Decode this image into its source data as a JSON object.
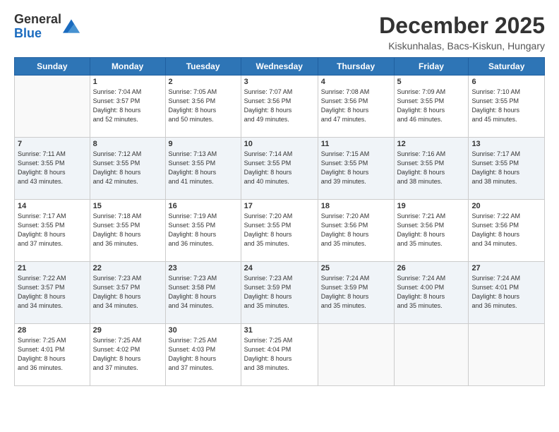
{
  "logo": {
    "line1": "General",
    "line2": "Blue"
  },
  "header": {
    "month": "December 2025",
    "location": "Kiskunhalas, Bacs-Kiskun, Hungary"
  },
  "weekdays": [
    "Sunday",
    "Monday",
    "Tuesday",
    "Wednesday",
    "Thursday",
    "Friday",
    "Saturday"
  ],
  "weeks": [
    [
      {
        "day": "",
        "info": ""
      },
      {
        "day": "1",
        "info": "Sunrise: 7:04 AM\nSunset: 3:57 PM\nDaylight: 8 hours\nand 52 minutes."
      },
      {
        "day": "2",
        "info": "Sunrise: 7:05 AM\nSunset: 3:56 PM\nDaylight: 8 hours\nand 50 minutes."
      },
      {
        "day": "3",
        "info": "Sunrise: 7:07 AM\nSunset: 3:56 PM\nDaylight: 8 hours\nand 49 minutes."
      },
      {
        "day": "4",
        "info": "Sunrise: 7:08 AM\nSunset: 3:56 PM\nDaylight: 8 hours\nand 47 minutes."
      },
      {
        "day": "5",
        "info": "Sunrise: 7:09 AM\nSunset: 3:55 PM\nDaylight: 8 hours\nand 46 minutes."
      },
      {
        "day": "6",
        "info": "Sunrise: 7:10 AM\nSunset: 3:55 PM\nDaylight: 8 hours\nand 45 minutes."
      }
    ],
    [
      {
        "day": "7",
        "info": "Sunrise: 7:11 AM\nSunset: 3:55 PM\nDaylight: 8 hours\nand 43 minutes."
      },
      {
        "day": "8",
        "info": "Sunrise: 7:12 AM\nSunset: 3:55 PM\nDaylight: 8 hours\nand 42 minutes."
      },
      {
        "day": "9",
        "info": "Sunrise: 7:13 AM\nSunset: 3:55 PM\nDaylight: 8 hours\nand 41 minutes."
      },
      {
        "day": "10",
        "info": "Sunrise: 7:14 AM\nSunset: 3:55 PM\nDaylight: 8 hours\nand 40 minutes."
      },
      {
        "day": "11",
        "info": "Sunrise: 7:15 AM\nSunset: 3:55 PM\nDaylight: 8 hours\nand 39 minutes."
      },
      {
        "day": "12",
        "info": "Sunrise: 7:16 AM\nSunset: 3:55 PM\nDaylight: 8 hours\nand 38 minutes."
      },
      {
        "day": "13",
        "info": "Sunrise: 7:17 AM\nSunset: 3:55 PM\nDaylight: 8 hours\nand 38 minutes."
      }
    ],
    [
      {
        "day": "14",
        "info": "Sunrise: 7:17 AM\nSunset: 3:55 PM\nDaylight: 8 hours\nand 37 minutes."
      },
      {
        "day": "15",
        "info": "Sunrise: 7:18 AM\nSunset: 3:55 PM\nDaylight: 8 hours\nand 36 minutes."
      },
      {
        "day": "16",
        "info": "Sunrise: 7:19 AM\nSunset: 3:55 PM\nDaylight: 8 hours\nand 36 minutes."
      },
      {
        "day": "17",
        "info": "Sunrise: 7:20 AM\nSunset: 3:55 PM\nDaylight: 8 hours\nand 35 minutes."
      },
      {
        "day": "18",
        "info": "Sunrise: 7:20 AM\nSunset: 3:56 PM\nDaylight: 8 hours\nand 35 minutes."
      },
      {
        "day": "19",
        "info": "Sunrise: 7:21 AM\nSunset: 3:56 PM\nDaylight: 8 hours\nand 35 minutes."
      },
      {
        "day": "20",
        "info": "Sunrise: 7:22 AM\nSunset: 3:56 PM\nDaylight: 8 hours\nand 34 minutes."
      }
    ],
    [
      {
        "day": "21",
        "info": "Sunrise: 7:22 AM\nSunset: 3:57 PM\nDaylight: 8 hours\nand 34 minutes."
      },
      {
        "day": "22",
        "info": "Sunrise: 7:23 AM\nSunset: 3:57 PM\nDaylight: 8 hours\nand 34 minutes."
      },
      {
        "day": "23",
        "info": "Sunrise: 7:23 AM\nSunset: 3:58 PM\nDaylight: 8 hours\nand 34 minutes."
      },
      {
        "day": "24",
        "info": "Sunrise: 7:23 AM\nSunset: 3:59 PM\nDaylight: 8 hours\nand 35 minutes."
      },
      {
        "day": "25",
        "info": "Sunrise: 7:24 AM\nSunset: 3:59 PM\nDaylight: 8 hours\nand 35 minutes."
      },
      {
        "day": "26",
        "info": "Sunrise: 7:24 AM\nSunset: 4:00 PM\nDaylight: 8 hours\nand 35 minutes."
      },
      {
        "day": "27",
        "info": "Sunrise: 7:24 AM\nSunset: 4:01 PM\nDaylight: 8 hours\nand 36 minutes."
      }
    ],
    [
      {
        "day": "28",
        "info": "Sunrise: 7:25 AM\nSunset: 4:01 PM\nDaylight: 8 hours\nand 36 minutes."
      },
      {
        "day": "29",
        "info": "Sunrise: 7:25 AM\nSunset: 4:02 PM\nDaylight: 8 hours\nand 37 minutes."
      },
      {
        "day": "30",
        "info": "Sunrise: 7:25 AM\nSunset: 4:03 PM\nDaylight: 8 hours\nand 37 minutes."
      },
      {
        "day": "31",
        "info": "Sunrise: 7:25 AM\nSunset: 4:04 PM\nDaylight: 8 hours\nand 38 minutes."
      },
      {
        "day": "",
        "info": ""
      },
      {
        "day": "",
        "info": ""
      },
      {
        "day": "",
        "info": ""
      }
    ]
  ]
}
